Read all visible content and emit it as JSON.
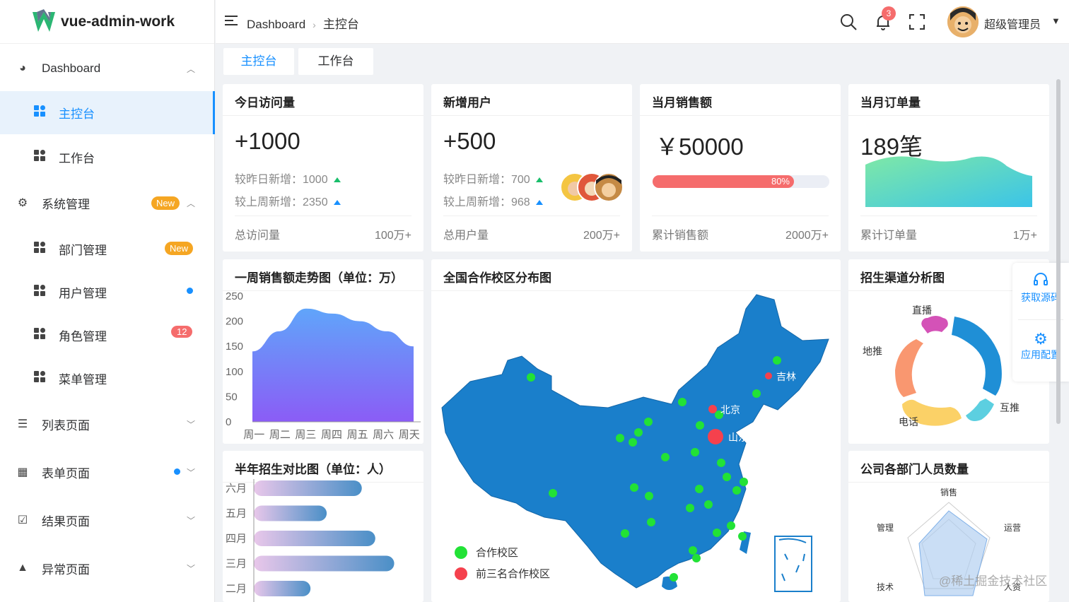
{
  "app": {
    "logo_text": "vue-admin-work"
  },
  "sidebar": {
    "items": [
      {
        "label": "Dashboard"
      },
      {
        "label": "主控台"
      },
      {
        "label": "工作台"
      },
      {
        "label": "系统管理",
        "badge": "New"
      },
      {
        "label": "部门管理",
        "badge": "New"
      },
      {
        "label": "用户管理"
      },
      {
        "label": "角色管理",
        "badge": "12"
      },
      {
        "label": "菜单管理"
      },
      {
        "label": "列表页面"
      },
      {
        "label": "表单页面"
      },
      {
        "label": "结果页面"
      },
      {
        "label": "异常页面"
      }
    ]
  },
  "header": {
    "breadcrumb": [
      "Dashboard",
      "主控台"
    ],
    "notification_count": "3",
    "user_name": "超级管理员"
  },
  "tabs": [
    "主控台",
    "工作台"
  ],
  "stats": [
    {
      "title": "今日访问量",
      "value": "+1000",
      "line1": "较昨日新增：1000",
      "line2": "较上周新增：2350",
      "footer_label": "总访问量",
      "footer_value": "100万+"
    },
    {
      "title": "新增用户",
      "value": "+500",
      "line1": "较昨日新增：700",
      "line2": "较上周新增：968",
      "footer_label": "总用户量",
      "footer_value": "200万+"
    },
    {
      "title": "当月销售额",
      "value": "￥50000",
      "progress": 80,
      "progress_label": "80%",
      "footer_label": "累计销售额",
      "footer_value": "2000万+"
    },
    {
      "title": "当月订单量",
      "value": "189笔",
      "footer_label": "累计订单量",
      "footer_value": "1万+"
    }
  ],
  "charts": {
    "weekly_title": "一周销售额走势图（单位：万）",
    "map_title": "全国合作校区分布图",
    "map_legend": [
      "合作校区",
      "前三名合作校区"
    ],
    "map_labels": [
      "吉林",
      "北京",
      "山东"
    ],
    "channel_title": "招生渠道分析图",
    "half_year_title": "半年招生对比图（单位：人）",
    "dept_title": "公司各部门人员数量"
  },
  "chart_data": [
    {
      "type": "area",
      "title": "一周销售额走势图（单位：万）",
      "categories": [
        "周一",
        "周二",
        "周三",
        "周四",
        "周五",
        "周六",
        "周天"
      ],
      "values": [
        140,
        180,
        225,
        215,
        200,
        180,
        150
      ],
      "ylim": [
        0,
        250
      ],
      "yticks": [
        "250",
        "200",
        "150",
        "100",
        "50",
        "0"
      ]
    },
    {
      "type": "pie",
      "title": "招生渠道分析图",
      "categories": [
        "直播",
        "地推",
        "电话",
        "互推"
      ],
      "values": [
        10,
        20,
        25,
        12
      ]
    },
    {
      "type": "bar",
      "title": "半年招生对比图（单位：人）",
      "categories": [
        "六月",
        "五月",
        "四月",
        "三月",
        "二月"
      ],
      "values": [
        400,
        270,
        450,
        520,
        210
      ]
    },
    {
      "type": "radar",
      "title": "公司各部门人员数量",
      "categories": [
        "销售",
        "运营",
        "人资",
        "技术",
        "管理"
      ]
    }
  ],
  "float_panel": {
    "btn1": "获取源码",
    "btn2": "应用配置"
  },
  "watermark": "@稀土掘金技术社区",
  "colors": {
    "primary": "#1890ff",
    "danger": "#f56c6c",
    "warning": "#f5a623",
    "map": "#1a7fcb"
  }
}
